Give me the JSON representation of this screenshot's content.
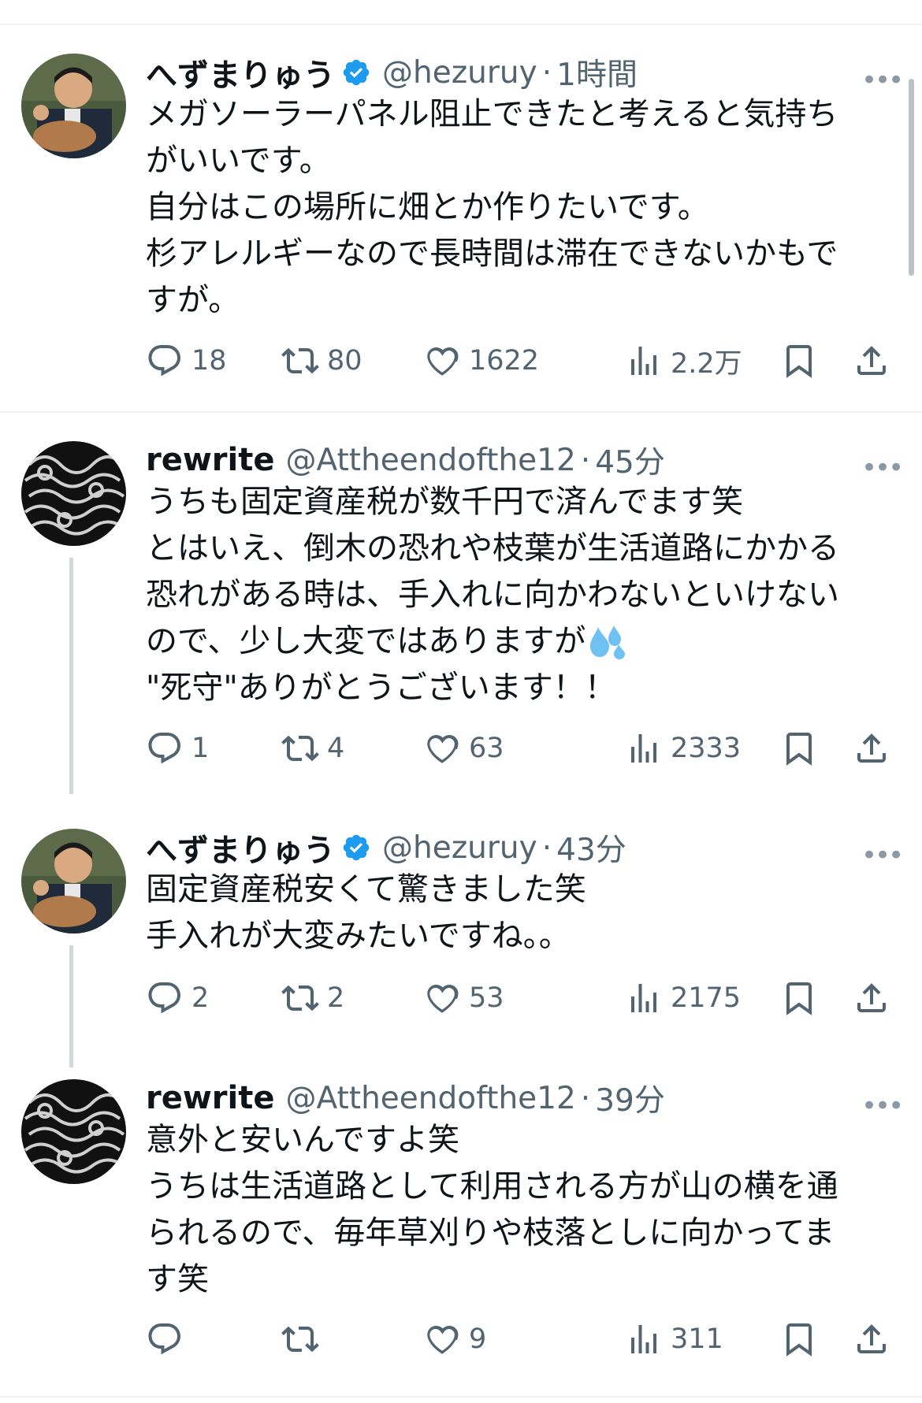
{
  "colors": {
    "verified": "#1d9bf0",
    "icon": "#536471",
    "text": "#0f1419",
    "muted": "#536471"
  },
  "tweets": [
    {
      "name": "へずまりゅう",
      "verified": true,
      "handle": "@hezuruy",
      "time": "1時間",
      "lines": [
        "メガソーラーパネル阻止できたと考えると気持ち",
        "がいいです。",
        "自分はこの場所に畑とか作りたいです。",
        "杉アレルギーなので長時間は滞在できないかもで",
        "すが。"
      ],
      "replies": "18",
      "reposts": "80",
      "likes": "1622",
      "views": "2.2万"
    },
    {
      "name": "rewrite",
      "verified": false,
      "handle": "@Attheendofthe12",
      "time": "45分",
      "lines": [
        "うちも固定資産税が数千円で済んでます笑",
        "とはいえ、倒木の恐れや枝葉が生活道路にかかる",
        "恐れがある時は、手入れに向かわないといけない",
        "ので、少し大変ではありますが",
        "\"死守\"ありがとうございます！！"
      ],
      "replies": "1",
      "reposts": "4",
      "likes": "63",
      "views": "2333"
    },
    {
      "name": "へずまりゅう",
      "verified": true,
      "handle": "@hezuruy",
      "time": "43分",
      "lines": [
        "固定資産税安くて驚きました笑",
        "手入れが大変みたいですね。。"
      ],
      "replies": "2",
      "reposts": "2",
      "likes": "53",
      "views": "2175"
    },
    {
      "name": "rewrite",
      "verified": false,
      "handle": "@Attheendofthe12",
      "time": "39分",
      "lines": [
        "意外と安いんですよ笑",
        "うちは生活道路として利用される方が山の横を通",
        "られるので、毎年草刈りや枝落としに向かってま",
        "す笑"
      ],
      "replies": "",
      "reposts": "",
      "likes": "9",
      "views": "311"
    }
  ]
}
